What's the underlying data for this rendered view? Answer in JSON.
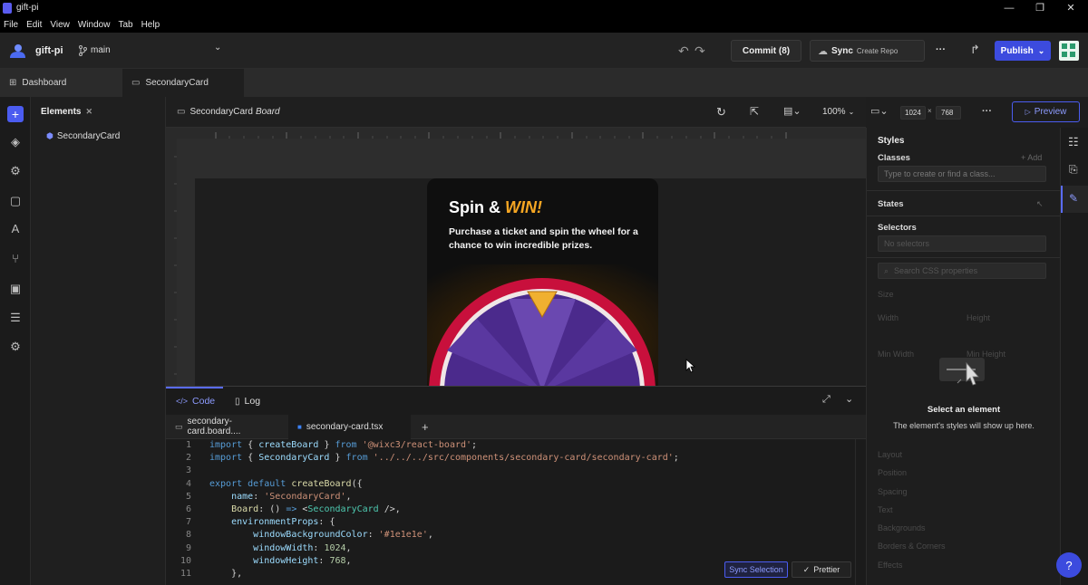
{
  "window": {
    "title": "gift-pi",
    "minimize": "—",
    "maximize": "❐",
    "close": "✕"
  },
  "menu": [
    "File",
    "Edit",
    "View",
    "Window",
    "Tab",
    "Help"
  ],
  "toolbar": {
    "project": "gift-pi",
    "branch": "main",
    "commit_label": "Commit (8)",
    "sync_label": "Sync",
    "sync_sub": "Create Repo",
    "more": "···",
    "publish_label": "Publish"
  },
  "tabs": [
    {
      "label": "Dashboard",
      "icon": "grid-icon"
    },
    {
      "label": "SecondaryCard",
      "icon": "monitor-icon"
    }
  ],
  "elements": {
    "title": "Elements",
    "item": "SecondaryCard"
  },
  "board": {
    "name": "SecondaryCard",
    "suffix": "Board",
    "zoom": "100%",
    "width": "1024",
    "times": "×",
    "height": "768",
    "more": "···",
    "preview_label": "Preview"
  },
  "card": {
    "title_plain": "Spin &",
    "title_accent": "WIN!",
    "description": "Purchase a ticket and spin the wheel for a chance to win incredible prizes."
  },
  "code_panel": {
    "code_tab": "Code",
    "log_tab": "Log",
    "file_tabs": [
      "secondary-card.board....",
      "secondary-card.tsx"
    ],
    "plus": "+",
    "sync_selection": "Sync Selection",
    "prettier": "Prettier",
    "lines": [
      "1",
      "2",
      "3",
      "4",
      "5",
      "6",
      "7",
      "8",
      "9",
      "10",
      "11"
    ]
  },
  "styles": {
    "title": "Styles",
    "classes_label": "Classes",
    "add_label": "+ Add",
    "class_placeholder": "Type to create or find a class...",
    "states_label": "States",
    "selectors_label": "Selectors",
    "no_selectors": "No selectors",
    "search_placeholder": "Search CSS properties",
    "faded": [
      "Size",
      "Width",
      "Height",
      "Min Width",
      "Min Height",
      "Layout",
      "Position",
      "Spacing",
      "Text",
      "Backgrounds",
      "Borders & Corners",
      "Effects"
    ],
    "empty_title": "Select an element",
    "empty_sub": "The element's styles will show up here."
  },
  "help": "?",
  "colors": {
    "accent": "#4b5cf0",
    "publish": "#3c4bde",
    "card_accent": "#f5a623",
    "wheel_red": "#c8103c",
    "wheel_purple": "#4b2a8c"
  }
}
